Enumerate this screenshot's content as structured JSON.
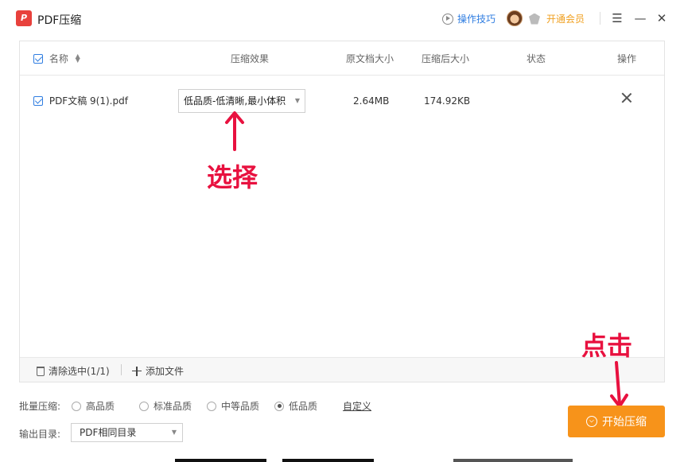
{
  "app": {
    "title": "PDF压缩",
    "logo_text": "P"
  },
  "header": {
    "tips_label": "操作技巧",
    "vip_label": "开通会员",
    "menu_glyph": "☰",
    "minimize_glyph": "—",
    "close_glyph": "✕"
  },
  "table": {
    "headers": {
      "name": "名称",
      "effect": "压缩效果",
      "orig_size": "原文档大小",
      "new_size": "压缩后大小",
      "status": "状态",
      "action": "操作"
    },
    "rows": [
      {
        "name": "PDF文稿 9(1).pdf",
        "effect": "低品质-低清晰,最小体积",
        "orig_size": "2.64MB",
        "new_size": "174.92KB",
        "status": ""
      }
    ]
  },
  "footer": {
    "clear_label": "清除选中(1/1)",
    "add_label": "添加文件"
  },
  "annotations": {
    "select": "选择",
    "click": "点击"
  },
  "options": {
    "batch_label": "批量压缩:",
    "qualities": [
      "高品质",
      "标准品质",
      "中等品质",
      "低品质"
    ],
    "selected_quality": "低品质",
    "custom_label": "自定义",
    "output_label": "输出目录:",
    "output_value": "PDF相同目录"
  },
  "start_button": "开始压缩",
  "colors": {
    "accent": "#f7931a",
    "link": "#2f7de1",
    "annotation": "#e8113f",
    "vip": "#f0a020"
  }
}
